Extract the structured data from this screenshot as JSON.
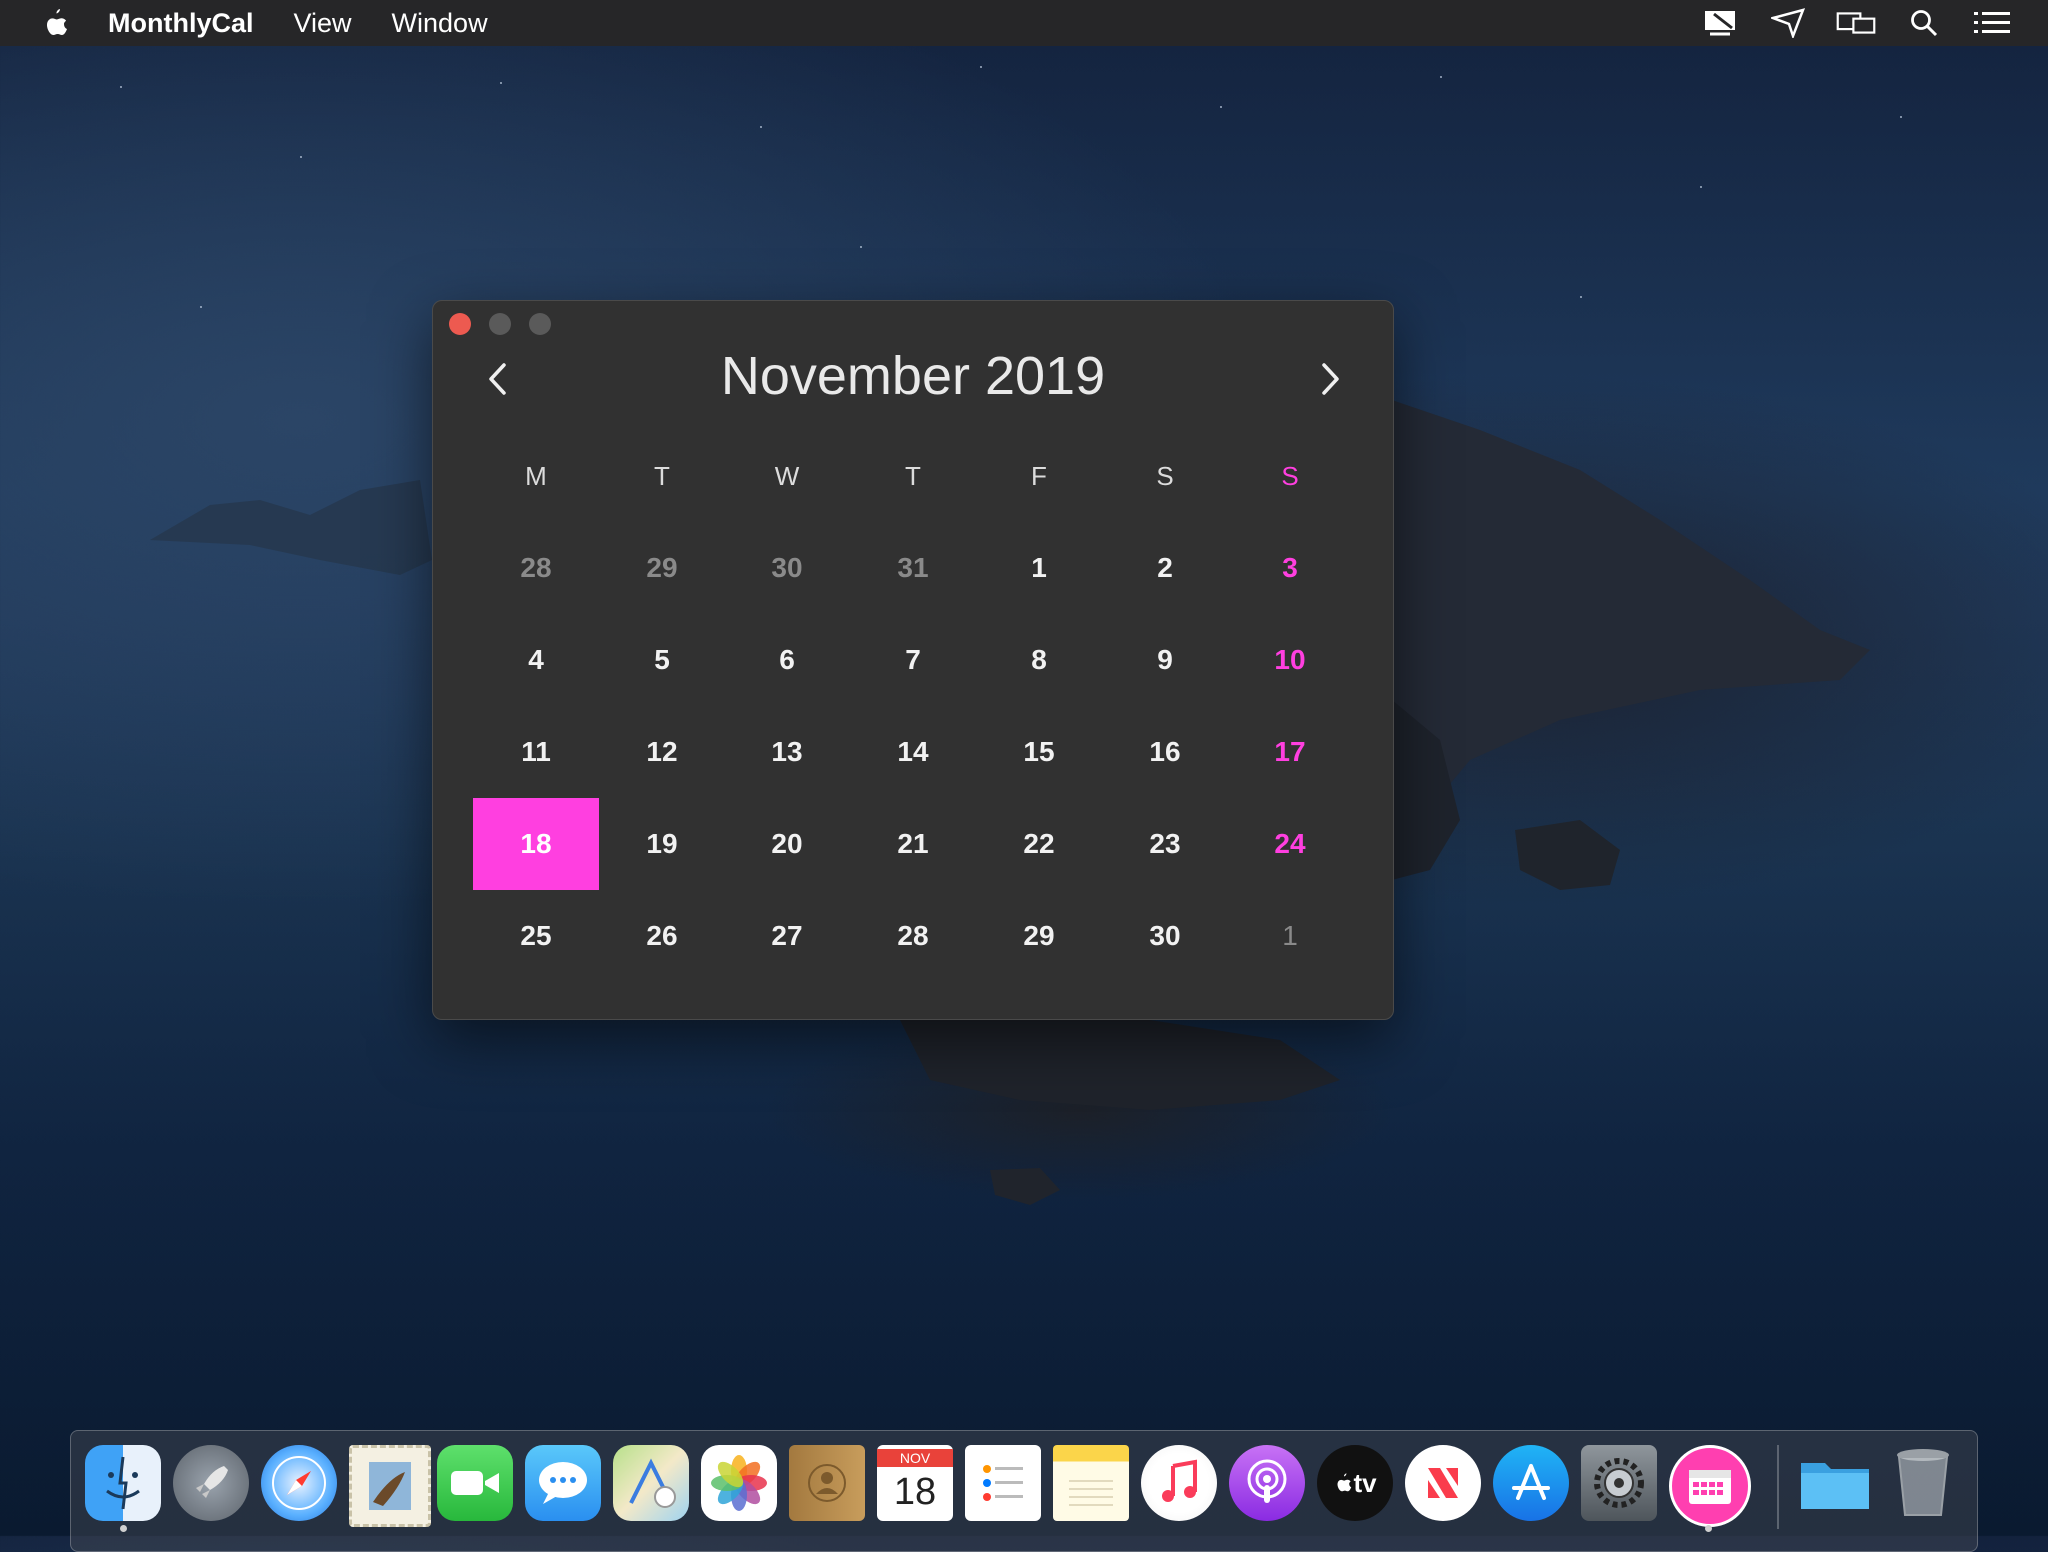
{
  "menubar": {
    "app_name": "MonthlyCal",
    "menus": [
      "View",
      "Window"
    ],
    "status_icons": [
      "airplay-display-icon",
      "location-arrow-icon",
      "screens-icon",
      "spotlight-search-icon",
      "notification-center-icon"
    ]
  },
  "calendar": {
    "title": "November 2019",
    "weekdays": [
      "M",
      "T",
      "W",
      "T",
      "F",
      "S",
      "S"
    ],
    "weeks": [
      [
        "28",
        "29",
        "30",
        "31",
        "1",
        "2",
        "3"
      ],
      [
        "4",
        "5",
        "6",
        "7",
        "8",
        "9",
        "10"
      ],
      [
        "11",
        "12",
        "13",
        "14",
        "15",
        "16",
        "17"
      ],
      [
        "18",
        "19",
        "20",
        "21",
        "22",
        "23",
        "24"
      ],
      [
        "25",
        "26",
        "27",
        "28",
        "29",
        "30",
        "1"
      ]
    ],
    "today": "18",
    "accent_color": "#ff3fe0"
  },
  "dock": {
    "calendar_icon": {
      "month": "NOV",
      "day": "18"
    },
    "apple_tv_label": "tv",
    "items": [
      "finder-icon",
      "launchpad-icon",
      "safari-icon",
      "mail-icon",
      "facetime-icon",
      "messages-icon",
      "maps-icon",
      "photos-icon",
      "contacts-icon",
      "calendar-icon",
      "reminders-icon",
      "notes-icon",
      "music-icon",
      "podcasts-icon",
      "apple-tv-icon",
      "news-icon",
      "app-store-icon",
      "system-preferences-icon",
      "monthlycal-icon",
      "downloads-folder-icon",
      "trash-icon"
    ]
  }
}
